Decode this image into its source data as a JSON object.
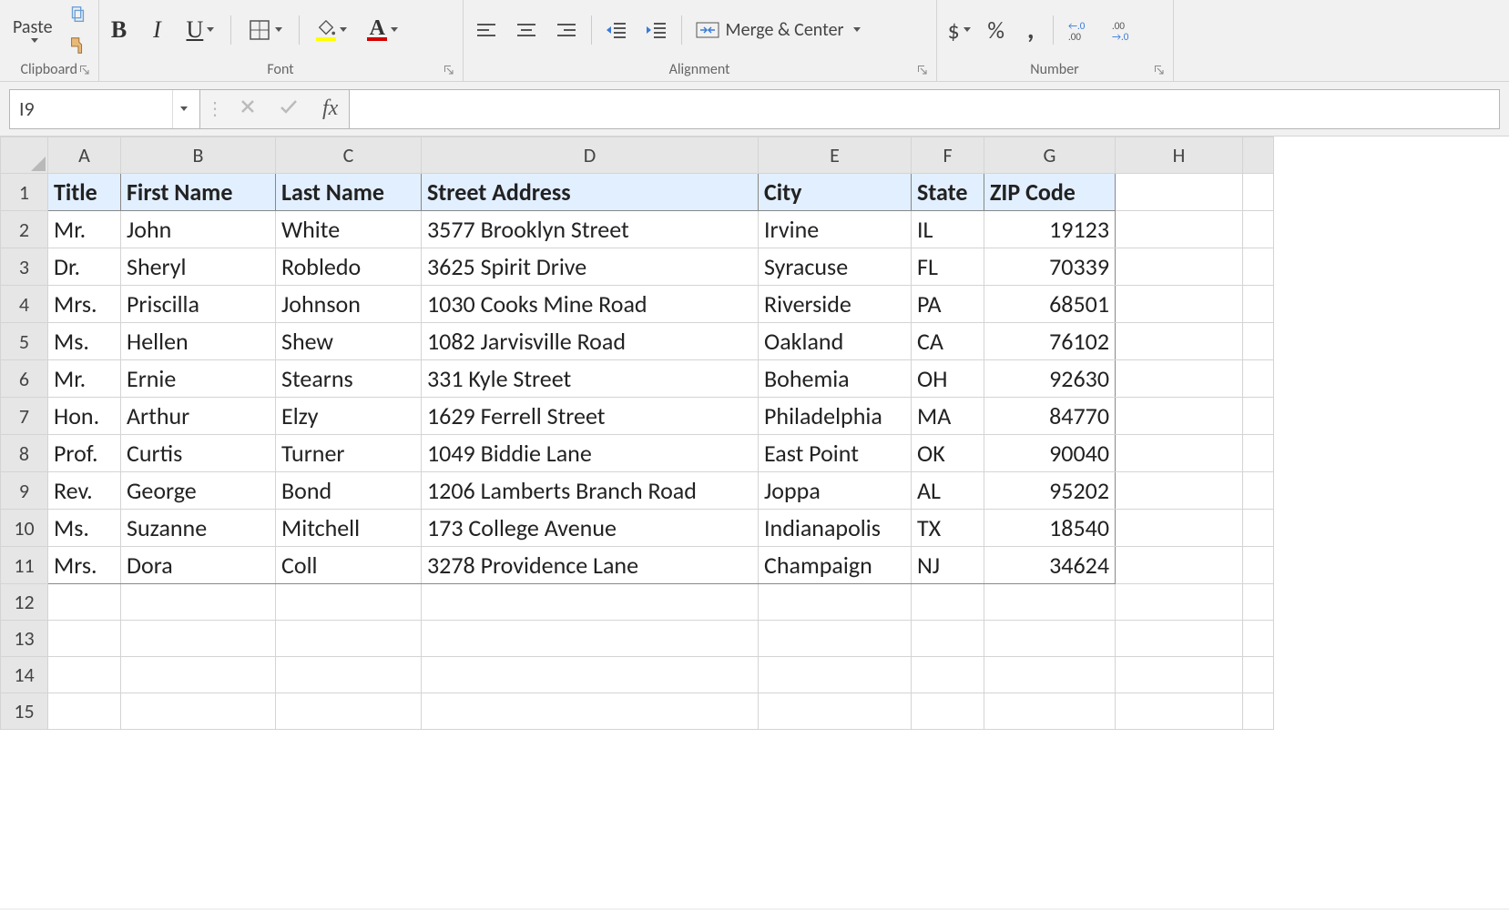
{
  "ribbon": {
    "clipboard": {
      "paste": "Paste",
      "group_label": "Clipboard"
    },
    "font": {
      "group_label": "Font",
      "bold": "B",
      "italic": "I",
      "underline": "U",
      "A": "A"
    },
    "alignment": {
      "group_label": "Alignment",
      "merge_center": "Merge & Center"
    },
    "number": {
      "group_label": "Number",
      "dollar": "$",
      "percent": "%",
      "comma": ","
    }
  },
  "formula_bar": {
    "namebox_value": "I9",
    "fx": "fx",
    "formula_value": ""
  },
  "sheet": {
    "column_letters": [
      "A",
      "B",
      "C",
      "D",
      "E",
      "F",
      "G",
      "H"
    ],
    "row_numbers": [
      "1",
      "2",
      "3",
      "4",
      "5",
      "6",
      "7",
      "8",
      "9",
      "10",
      "11",
      "12",
      "13",
      "14",
      "15"
    ],
    "headers": [
      "Title",
      "First Name",
      "Last Name",
      "Street Address",
      "City",
      "State",
      "ZIP Code"
    ],
    "rows": [
      {
        "title": "Mr.",
        "first": "John",
        "last": "White",
        "street": "3577 Brooklyn Street",
        "city": "Irvine",
        "state": "IL",
        "zip": "19123"
      },
      {
        "title": "Dr.",
        "first": "Sheryl",
        "last": "Robledo",
        "street": "3625 Spirit Drive",
        "city": "Syracuse",
        "state": "FL",
        "zip": "70339"
      },
      {
        "title": "Mrs.",
        "first": "Priscilla",
        "last": "Johnson",
        "street": "1030 Cooks Mine Road",
        "city": "Riverside",
        "state": "PA",
        "zip": "68501"
      },
      {
        "title": "Ms.",
        "first": "Hellen",
        "last": "Shew",
        "street": "1082 Jarvisville Road",
        "city": "Oakland",
        "state": "CA",
        "zip": "76102"
      },
      {
        "title": "Mr.",
        "first": "Ernie",
        "last": "Stearns",
        "street": "331 Kyle Street",
        "city": "Bohemia",
        "state": "OH",
        "zip": "92630"
      },
      {
        "title": "Hon.",
        "first": "Arthur",
        "last": "Elzy",
        "street": "1629 Ferrell Street",
        "city": "Philadelphia",
        "state": "MA",
        "zip": "84770"
      },
      {
        "title": "Prof.",
        "first": "Curtis",
        "last": "Turner",
        "street": "1049 Biddie Lane",
        "city": "East Point",
        "state": "OK",
        "zip": "90040"
      },
      {
        "title": "Rev.",
        "first": "George",
        "last": "Bond",
        "street": "1206 Lamberts Branch Road",
        "city": "Joppa",
        "state": "AL",
        "zip": "95202"
      },
      {
        "title": "Ms.",
        "first": "Suzanne",
        "last": "Mitchell",
        "street": "173 College Avenue",
        "city": "Indianapolis",
        "state": "TX",
        "zip": "18540"
      },
      {
        "title": "Mrs.",
        "first": "Dora",
        "last": "Coll",
        "street": "3278 Providence Lane",
        "city": "Champaign",
        "state": "NJ",
        "zip": "34624"
      }
    ]
  }
}
